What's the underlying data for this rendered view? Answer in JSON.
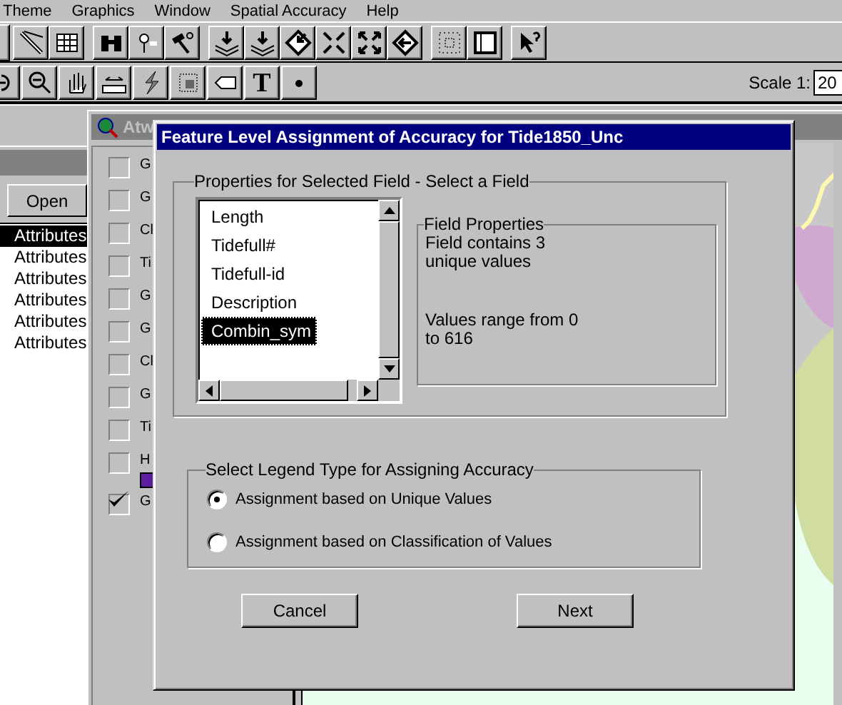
{
  "menu_bar": [
    {
      "label": "Theme"
    },
    {
      "label": "Graphics"
    },
    {
      "label": "Window"
    },
    {
      "label": "Spatial Accuracy"
    },
    {
      "label": "Help"
    }
  ],
  "toolbar_2": {
    "text_tool": "T"
  },
  "scale": {
    "label": "Scale 1:",
    "value": "20"
  },
  "project_window": {
    "open_button": "Open",
    "items": [
      {
        "label": "Attributes",
        "selected": true
      },
      {
        "label": "Attributes",
        "selected": false
      },
      {
        "label": "Attributes",
        "selected": false
      },
      {
        "label": "Attributes",
        "selected": false
      },
      {
        "label": "Attributes",
        "selected": false
      },
      {
        "label": "Attributes",
        "selected": false
      }
    ]
  },
  "view_window": {
    "title": "Atw",
    "legend": [
      {
        "label": "G",
        "checked": false
      },
      {
        "label": "G",
        "checked": false
      },
      {
        "label": "Cl",
        "checked": false
      },
      {
        "label": "Ti",
        "checked": false
      },
      {
        "label": "G",
        "checked": false
      },
      {
        "label": "G",
        "checked": false
      },
      {
        "label": "Cl",
        "checked": false
      },
      {
        "label": "G",
        "checked": false
      },
      {
        "label": "Ti",
        "checked": false
      },
      {
        "label": "H",
        "checked": false,
        "color": "#5a1ea0"
      },
      {
        "label": "G",
        "checked": true
      }
    ]
  },
  "dialog": {
    "title": "Feature Level Assignment of Accuracy for Tide1850_Unc",
    "field_group": "Properties for Selected Field - Select a Field",
    "fields": [
      {
        "label": "Length",
        "selected": false
      },
      {
        "label": "Tidefull#",
        "selected": false
      },
      {
        "label": "Tidefull-id",
        "selected": false
      },
      {
        "label": "Description",
        "selected": false
      },
      {
        "label": "Combin_sym",
        "selected": true
      }
    ],
    "field_properties": {
      "label": "Field Properties",
      "paragraphs": [
        [
          "Field contains 3",
          "unique values"
        ],
        [
          "Values range from 0",
          "to 616"
        ]
      ]
    },
    "legend_group": "Select Legend Type for Assigning Accuracy",
    "options": [
      {
        "label": "Assignment based on Unique Values",
        "selected": true
      },
      {
        "label": "Assignment based on Classification of Values",
        "selected": false
      }
    ],
    "buttons": [
      "Cancel",
      "Next"
    ]
  }
}
